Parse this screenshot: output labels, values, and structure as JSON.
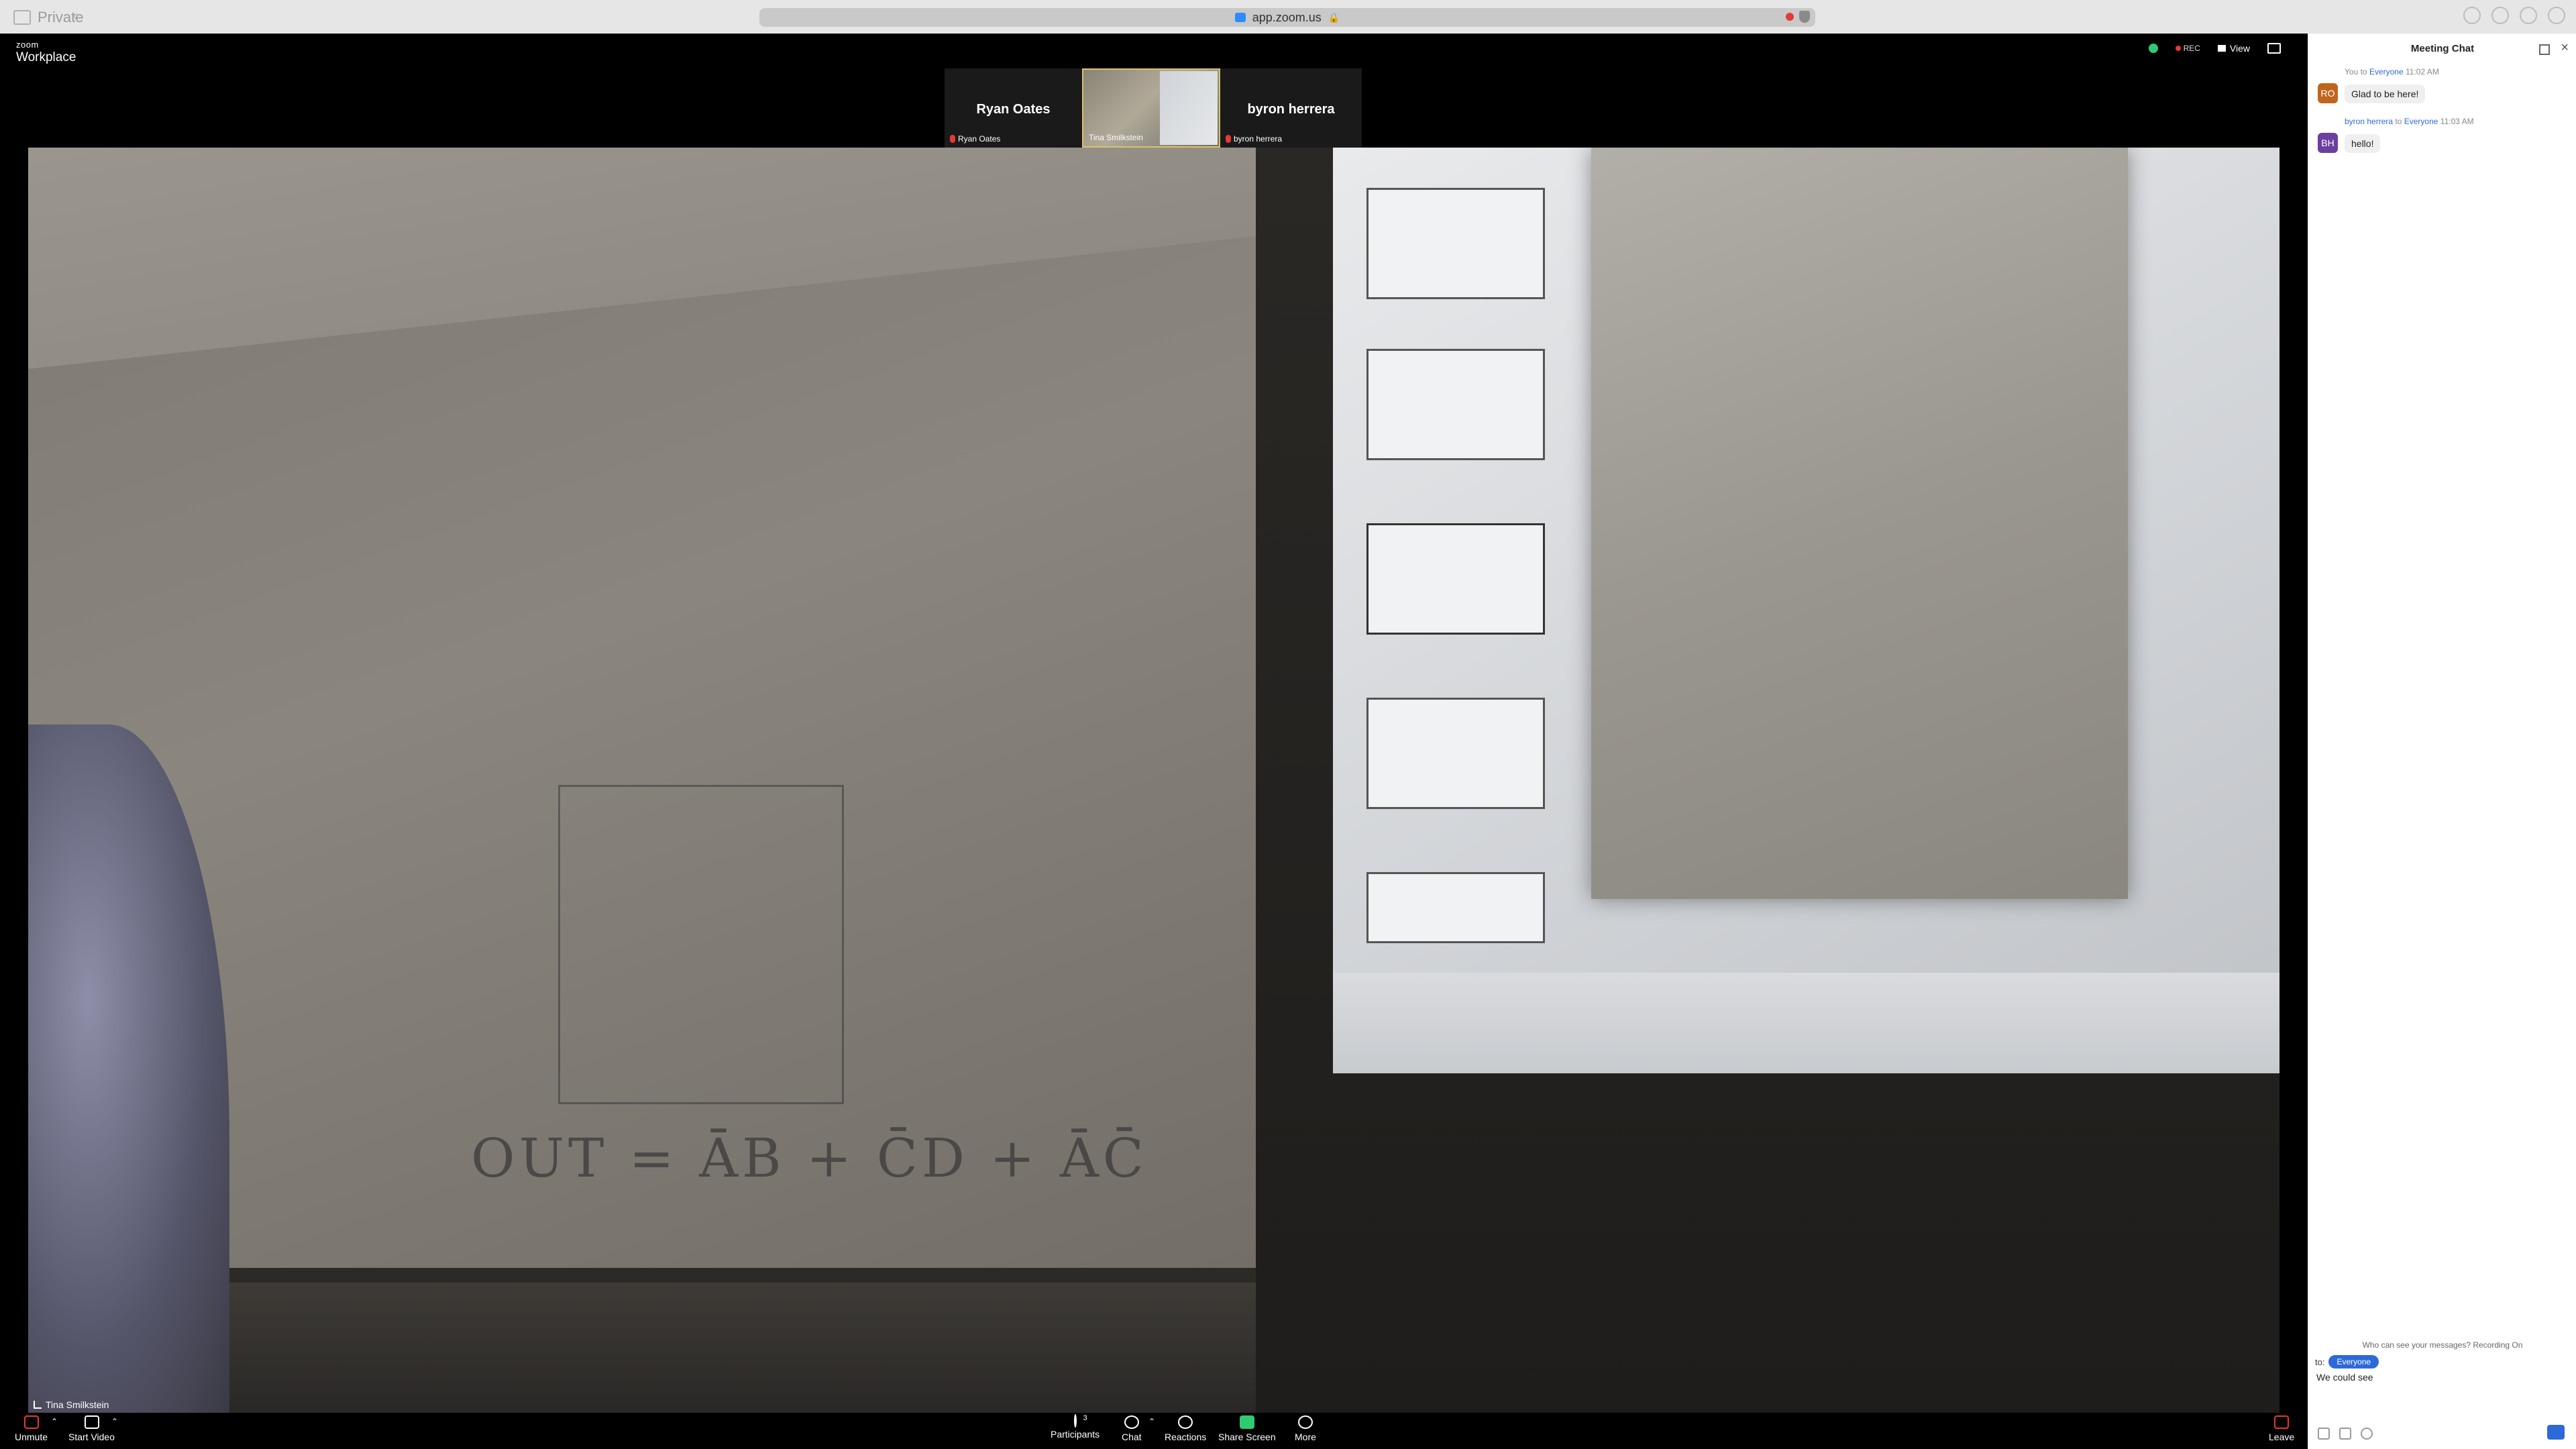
{
  "browser": {
    "private_label": "Private",
    "url": "app.zoom.us"
  },
  "zoom_header": {
    "brand_small": "zoom",
    "brand": "Workplace",
    "rec_label": "REC",
    "view_label": "View"
  },
  "thumbnails": [
    {
      "name_big": "Ryan Oates",
      "name_small": "Ryan Oates"
    },
    {
      "name_small": "Tina Smilkstein"
    },
    {
      "name_big": "byron herrera",
      "name_small": "byron herrera"
    }
  ],
  "main_video": {
    "label": "Tina Smilkstein",
    "board_text": "OUT = ĀB + C̄D + ĀC̄"
  },
  "toolbar": {
    "unmute": "Unmute",
    "start_video": "Start Video",
    "participants": "Participants",
    "participants_count": "3",
    "chat": "Chat",
    "reactions": "Reactions",
    "share_screen": "Share Screen",
    "more": "More",
    "leave": "Leave"
  },
  "chat": {
    "title": "Meeting Chat",
    "messages": [
      {
        "sender": "You",
        "to_word": "to",
        "recipient": "Everyone",
        "time": "11:02 AM",
        "initials": "RO",
        "text": "Glad to be here!",
        "color": "#c0651f"
      },
      {
        "sender": "byron herrera",
        "to_word": "to",
        "recipient": "Everyone",
        "time": "11:03 AM",
        "initials": "BH",
        "text": "hello!",
        "color": "#6b3fa0"
      }
    ],
    "who_can_see": "Who can see your messages? Recording On",
    "to_label": "to:",
    "to_value": "Everyone",
    "input_value": "We could see"
  }
}
